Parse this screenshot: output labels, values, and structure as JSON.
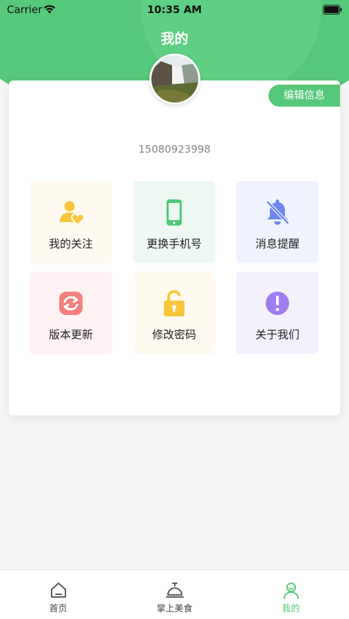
{
  "status_bar": {
    "carrier": "Carrier",
    "time": "10:35 AM"
  },
  "header": {
    "title": "我的"
  },
  "profile": {
    "edit_label": "编辑信息",
    "phone": "15080923998"
  },
  "menu": [
    {
      "label": "我的关注",
      "icon": "heart-user-icon",
      "color": "#f8c53d",
      "bg": "#fffaf0"
    },
    {
      "label": "更换手机号",
      "icon": "phone-icon",
      "color": "#4cc97a",
      "bg": "#eef8f2"
    },
    {
      "label": "消息提醒",
      "icon": "bell-off-icon",
      "color": "#6f86f0",
      "bg": "#f0f3fd"
    },
    {
      "label": "版本更新",
      "icon": "refresh-icon",
      "color": "#f57f7f",
      "bg": "#fff2f4"
    },
    {
      "label": "修改密码",
      "icon": "unlock-icon",
      "color": "#f8c53d",
      "bg": "#fffaf0"
    },
    {
      "label": "关于我们",
      "icon": "info-icon",
      "color": "#a07ef0",
      "bg": "#f4f1fd"
    }
  ],
  "tabs": [
    {
      "label": "首页",
      "icon": "home-icon",
      "active": false
    },
    {
      "label": "掌上美食",
      "icon": "food-bell-icon",
      "active": false
    },
    {
      "label": "我的",
      "icon": "user-icon",
      "active": true
    }
  ],
  "colors": {
    "accent": "#56c87a",
    "background": "#f5f5f5"
  }
}
